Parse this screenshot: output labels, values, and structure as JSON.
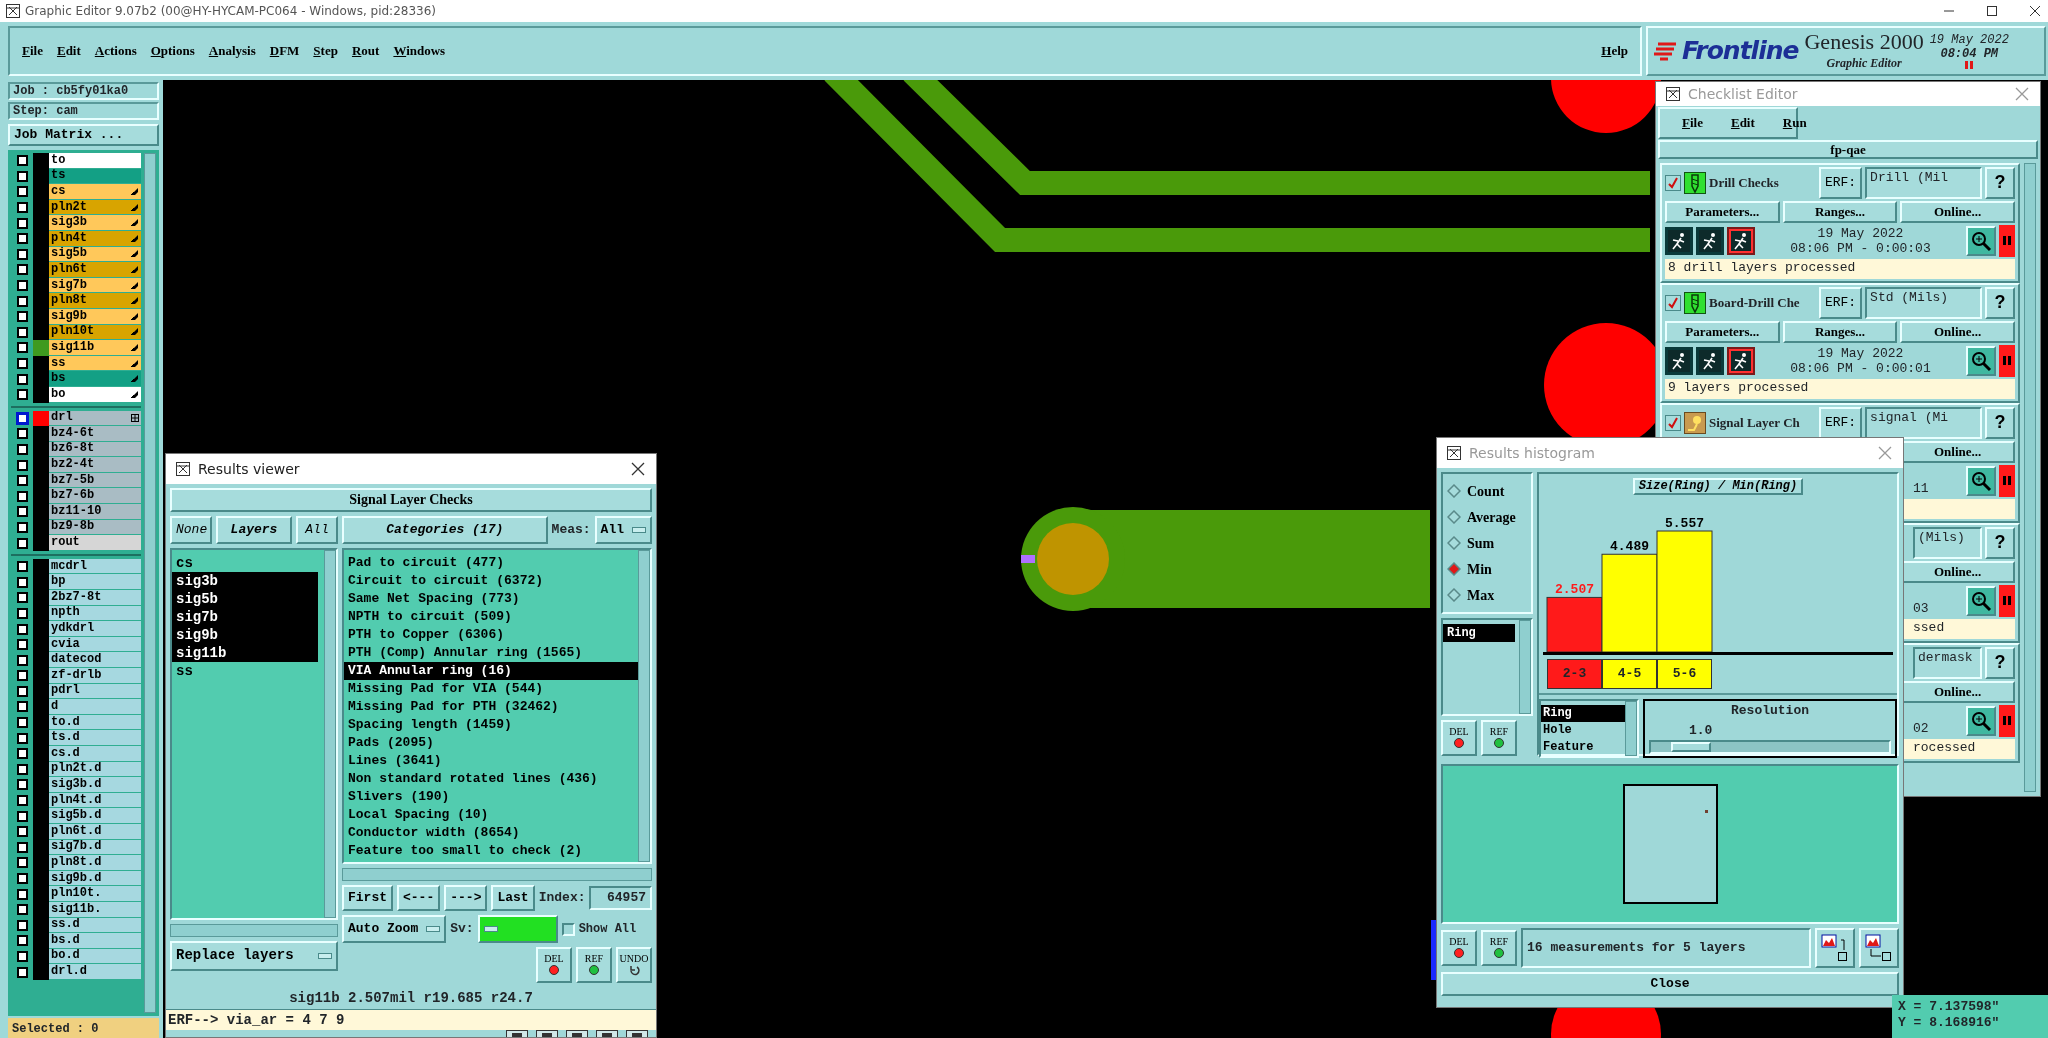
{
  "window": {
    "title": "Graphic Editor 9.07b2 (00@HY-HYCAM-PC064 - Windows, pid:28336)"
  },
  "menu": {
    "items": [
      "File",
      "Edit",
      "Actions",
      "Options",
      "Analysis",
      "DFM",
      "Step",
      "Rout",
      "Windows"
    ],
    "help": "Help"
  },
  "logo": {
    "brand": "Frontline",
    "product": "Genesis 2000",
    "subtitle": "Graphic Editor",
    "date": "19 May 2022",
    "time": "08:04 PM"
  },
  "job_panel": {
    "job": "Job : cb5fy01ka0",
    "step": "Step: cam",
    "matrix_button": "Job Matrix ...",
    "selected": "Selected : 0",
    "layer_groups": [
      [
        {
          "name": "to",
          "color": "#ffffff",
          "kind": "plain",
          "checked": false,
          "displayed": false,
          "work_layer": false
        },
        {
          "name": "ts",
          "color": "#13a085",
          "kind": "plain",
          "checked": false,
          "displayed": false,
          "work_layer": false
        },
        {
          "name": "cs",
          "color": "#ffc85a",
          "kind": "marked",
          "checked": false,
          "displayed": false,
          "work_layer": false
        },
        {
          "name": "pln2t",
          "color": "#d8a400",
          "kind": "marked",
          "checked": false,
          "displayed": false,
          "work_layer": false
        },
        {
          "name": "sig3b",
          "color": "#ffc85a",
          "kind": "marked",
          "checked": false,
          "displayed": false,
          "work_layer": false
        },
        {
          "name": "pln4t",
          "color": "#d8a400",
          "kind": "marked",
          "checked": false,
          "displayed": false,
          "work_layer": false
        },
        {
          "name": "sig5b",
          "color": "#ffc85a",
          "kind": "marked",
          "checked": false,
          "displayed": false,
          "work_layer": false
        },
        {
          "name": "pln6t",
          "color": "#d8a400",
          "kind": "marked",
          "checked": false,
          "displayed": false,
          "work_layer": false
        },
        {
          "name": "sig7b",
          "color": "#ffc85a",
          "kind": "marked",
          "checked": false,
          "displayed": false,
          "work_layer": false
        },
        {
          "name": "pln8t",
          "color": "#d8a400",
          "kind": "marked",
          "checked": false,
          "displayed": false,
          "work_layer": false
        },
        {
          "name": "sig9b",
          "color": "#ffc85a",
          "kind": "marked",
          "checked": false,
          "displayed": false,
          "work_layer": false
        },
        {
          "name": "pln10t",
          "color": "#d8a400",
          "kind": "marked",
          "checked": false,
          "displayed": false,
          "work_layer": false
        },
        {
          "name": "sig11b",
          "color": "#ffc85a",
          "kind": "marked",
          "checked": false,
          "displayed": true,
          "work_layer": false
        },
        {
          "name": "ss",
          "color": "#ffc85a",
          "kind": "marked",
          "checked": false,
          "displayed": false,
          "work_layer": false
        },
        {
          "name": "bs",
          "color": "#13a085",
          "kind": "marked",
          "checked": false,
          "displayed": false,
          "work_layer": false
        },
        {
          "name": "bo",
          "color": "#ffffff",
          "kind": "marked",
          "checked": false,
          "displayed": false,
          "work_layer": false
        }
      ],
      [
        {
          "name": "drl",
          "color": "#a9bcc4",
          "kind": "grid",
          "checked": false,
          "displayed": false,
          "work_layer": true
        },
        {
          "name": "bz4-6t",
          "color": "#a9bcc4",
          "kind": "plain",
          "checked": false,
          "displayed": false,
          "work_layer": false
        },
        {
          "name": "bz6-8t",
          "color": "#a9bcc4",
          "kind": "plain",
          "checked": false,
          "displayed": false,
          "work_layer": false
        },
        {
          "name": "bz2-4t",
          "color": "#a9bcc4",
          "kind": "plain",
          "checked": false,
          "displayed": false,
          "work_layer": false
        },
        {
          "name": "bz7-5b",
          "color": "#a9bcc4",
          "kind": "plain",
          "checked": false,
          "displayed": false,
          "work_layer": false
        },
        {
          "name": "bz7-6b",
          "color": "#a9bcc4",
          "kind": "plain",
          "checked": false,
          "displayed": false,
          "work_layer": false
        },
        {
          "name": "bz11-10",
          "color": "#a9bcc4",
          "kind": "plain",
          "checked": false,
          "displayed": false,
          "work_layer": false
        },
        {
          "name": "bz9-8b",
          "color": "#a9bcc4",
          "kind": "plain",
          "checked": false,
          "displayed": false,
          "work_layer": false
        },
        {
          "name": "rout",
          "color": "#d6d6d6",
          "kind": "plain",
          "checked": false,
          "displayed": false,
          "work_layer": false
        }
      ],
      [
        {
          "name": "mcdrl",
          "color": "#a6d8e0",
          "kind": "plain",
          "checked": false,
          "displayed": false,
          "work_layer": false
        },
        {
          "name": "bp",
          "color": "#a6d8e0",
          "kind": "plain",
          "checked": false,
          "displayed": false,
          "work_layer": false
        },
        {
          "name": "2bz7-8t",
          "color": "#a6d8e0",
          "kind": "plain",
          "checked": false,
          "displayed": false,
          "work_layer": false
        },
        {
          "name": "npth",
          "color": "#a6d8e0",
          "kind": "plain",
          "checked": false,
          "displayed": false,
          "work_layer": false
        },
        {
          "name": "ydkdrl",
          "color": "#a6d8e0",
          "kind": "plain",
          "checked": false,
          "displayed": false,
          "work_layer": false
        },
        {
          "name": "cvia",
          "color": "#a6d8e0",
          "kind": "plain",
          "checked": false,
          "displayed": false,
          "work_layer": false
        },
        {
          "name": "datecod",
          "color": "#a6d8e0",
          "kind": "plain",
          "checked": false,
          "displayed": false,
          "work_layer": false
        },
        {
          "name": "zf-drlb",
          "color": "#a6d8e0",
          "kind": "plain",
          "checked": false,
          "displayed": false,
          "work_layer": false
        },
        {
          "name": "pdrl",
          "color": "#a6d8e0",
          "kind": "plain",
          "checked": false,
          "displayed": false,
          "work_layer": false
        },
        {
          "name": "d",
          "color": "#a6d8e0",
          "kind": "plain",
          "checked": false,
          "displayed": false,
          "work_layer": false
        },
        {
          "name": "to.d",
          "color": "#a6d8e0",
          "kind": "plain",
          "checked": false,
          "displayed": false,
          "work_layer": false
        },
        {
          "name": "ts.d",
          "color": "#a6d8e0",
          "kind": "plain",
          "checked": false,
          "displayed": false,
          "work_layer": false
        },
        {
          "name": "cs.d",
          "color": "#a6d8e0",
          "kind": "plain",
          "checked": false,
          "displayed": false,
          "work_layer": false
        },
        {
          "name": "pln2t.d",
          "color": "#a6d8e0",
          "kind": "plain",
          "checked": false,
          "displayed": false,
          "work_layer": false
        },
        {
          "name": "sig3b.d",
          "color": "#a6d8e0",
          "kind": "plain",
          "checked": false,
          "displayed": false,
          "work_layer": false
        },
        {
          "name": "pln4t.d",
          "color": "#a6d8e0",
          "kind": "plain",
          "checked": false,
          "displayed": false,
          "work_layer": false
        },
        {
          "name": "sig5b.d",
          "color": "#a6d8e0",
          "kind": "plain",
          "checked": false,
          "displayed": false,
          "work_layer": false
        },
        {
          "name": "pln6t.d",
          "color": "#a6d8e0",
          "kind": "plain",
          "checked": false,
          "displayed": false,
          "work_layer": false
        },
        {
          "name": "sig7b.d",
          "color": "#a6d8e0",
          "kind": "plain",
          "checked": false,
          "displayed": false,
          "work_layer": false
        },
        {
          "name": "pln8t.d",
          "color": "#a6d8e0",
          "kind": "plain",
          "checked": false,
          "displayed": false,
          "work_layer": false
        },
        {
          "name": "sig9b.d",
          "color": "#a6d8e0",
          "kind": "plain",
          "checked": false,
          "displayed": false,
          "work_layer": false
        },
        {
          "name": "pln10t.",
          "color": "#a6d8e0",
          "kind": "plain",
          "checked": false,
          "displayed": false,
          "work_layer": false
        },
        {
          "name": "sig11b.",
          "color": "#a6d8e0",
          "kind": "plain",
          "checked": false,
          "displayed": false,
          "work_layer": false
        },
        {
          "name": "ss.d",
          "color": "#a6d8e0",
          "kind": "plain",
          "checked": false,
          "displayed": false,
          "work_layer": false
        },
        {
          "name": "bs.d",
          "color": "#a6d8e0",
          "kind": "plain",
          "checked": false,
          "displayed": false,
          "work_layer": false
        },
        {
          "name": "bo.d",
          "color": "#a6d8e0",
          "kind": "plain",
          "checked": false,
          "displayed": false,
          "work_layer": false
        },
        {
          "name": "drl.d",
          "color": "#a6d8e0",
          "kind": "plain",
          "checked": false,
          "displayed": false,
          "work_layer": false
        }
      ]
    ]
  },
  "results_viewer": {
    "title": "Results viewer",
    "check": "Signal Layer Checks",
    "layer_buttons": [
      "None",
      "Layers",
      "All"
    ],
    "layers": [
      {
        "name": "cs",
        "selected": false
      },
      {
        "name": "sig3b",
        "selected": true
      },
      {
        "name": "sig5b",
        "selected": true
      },
      {
        "name": "sig7b",
        "selected": true
      },
      {
        "name": "sig9b",
        "selected": true
      },
      {
        "name": "sig11b",
        "selected": true
      },
      {
        "name": "ss",
        "selected": false
      }
    ],
    "replace": "Replace layers",
    "categories_header": "Categories (17)",
    "meas_label": "Meas:",
    "meas_value": "All",
    "categories": [
      {
        "label": "Pad to circuit (477)",
        "selected": false
      },
      {
        "label": "Circuit to circuit (6372)",
        "selected": false
      },
      {
        "label": "Same Net Spacing (773)",
        "selected": false
      },
      {
        "label": "NPTH to circuit (509)",
        "selected": false
      },
      {
        "label": "PTH to Copper (6306)",
        "selected": false
      },
      {
        "label": "PTH (Comp) Annular ring (1565)",
        "selected": false
      },
      {
        "label": "VIA Annular ring (16)",
        "selected": true
      },
      {
        "label": "Missing Pad for VIA (544)",
        "selected": false
      },
      {
        "label": "Missing Pad for PTH (32462)",
        "selected": false
      },
      {
        "label": "Spacing length (1459)",
        "selected": false
      },
      {
        "label": "Pads (2095)",
        "selected": false
      },
      {
        "label": "Lines (3641)",
        "selected": false
      },
      {
        "label": "Non standard rotated lines (436)",
        "selected": false
      },
      {
        "label": "Slivers (190)",
        "selected": false
      },
      {
        "label": "Local Spacing (10)",
        "selected": false
      },
      {
        "label": "Conductor width (8654)",
        "selected": false
      },
      {
        "label": "Feature too small to check (2)",
        "selected": false
      }
    ],
    "nav": [
      "First",
      "<---",
      "--->",
      "Last"
    ],
    "index_label": "Index:",
    "index_value": "64957",
    "zoom_mode": "Auto Zoom",
    "sv_label": "Sv:",
    "show_all": {
      "label": "Show All",
      "checked": false
    },
    "tools": [
      {
        "label": "DEL",
        "kind": "del"
      },
      {
        "label": "REF",
        "kind": "ref"
      },
      {
        "label": "UNDO",
        "kind": "undo"
      }
    ],
    "status": "sig11b 2.507mil r19.685 r24.7",
    "erf_line": "ERF--> via_ar = 4 7 9"
  },
  "checklist": {
    "title": "Checklist Editor",
    "menu": [
      "File",
      "Edit",
      "Run"
    ],
    "name": "fp-qae",
    "checks": [
      {
        "name": "Drill Checks",
        "checked": true,
        "kind": "drill",
        "erf_label": "ERF:",
        "erf_value": "Drill (Mil",
        "help": "?",
        "buttons": [
          "Parameters...",
          "Ranges...",
          "Online..."
        ],
        "date": "19 May 2022",
        "time": "08:06 PM - 0:00:03",
        "status": "8 drill layers processed"
      },
      {
        "name": "Board-Drill Che",
        "checked": true,
        "kind": "drill",
        "erf_label": "ERF:",
        "erf_value": "Std (Mils)",
        "help": "?",
        "buttons": [
          "Parameters...",
          "Ranges...",
          "Online..."
        ],
        "date": "19 May 2022",
        "time": "08:06 PM - 0:00:01",
        "status": "9 layers processed"
      },
      {
        "name": "Signal Layer Ch",
        "checked": true,
        "kind": "signal",
        "erf_label": "ERF:",
        "erf_value": "signal (Mi",
        "help": "?",
        "buttons": [
          "Online..."
        ],
        "time": "11"
      },
      {
        "erf_value": "(Mils)",
        "help": "?",
        "buttons": [
          "Online..."
        ],
        "time": "03",
        "status": "ssed"
      },
      {
        "erf_value": "dermask",
        "help": "?",
        "buttons": [
          "Online..."
        ],
        "time": "02",
        "status": "rocessed"
      }
    ]
  },
  "histogram": {
    "title": "Results histogram",
    "modes": [
      {
        "label": "Count",
        "selected": false
      },
      {
        "label": "Average",
        "selected": false
      },
      {
        "label": "Sum",
        "selected": false
      },
      {
        "label": "Min",
        "selected": true
      },
      {
        "label": "Max",
        "selected": false
      }
    ],
    "attributes": [
      {
        "label": "Ring",
        "selected": true
      }
    ],
    "tools": [
      {
        "label": "DEL",
        "kind": "del"
      },
      {
        "label": "REF",
        "kind": "ref"
      }
    ],
    "chart_data": {
      "type": "bar",
      "title": "Size(Ring) / Min(Ring)",
      "categories": [
        "2-3",
        "4-5",
        "5-6"
      ],
      "series": [
        {
          "color": "#ff1a1a",
          "values": [
            2.507,
            null,
            null
          ]
        },
        {
          "color": "#ffff00",
          "values": [
            null,
            4.489,
            5.557
          ]
        }
      ],
      "stacked": true,
      "data_labels": true
    },
    "fields": [
      {
        "label": "Ring",
        "selected": true
      },
      {
        "label": "Hole",
        "selected": false
      },
      {
        "label": "Feature",
        "selected": false
      }
    ],
    "resolution": {
      "label": "Resolution",
      "value": "1.0",
      "level": 0.1
    },
    "bottom_tools": [
      {
        "label": "DEL",
        "kind": "del"
      },
      {
        "label": "REF",
        "kind": "ref"
      }
    ],
    "summary": "16 measurements for 5 layers",
    "close": "Close"
  },
  "coordinates": {
    "x": "X = 7.137598\"",
    "y": "Y = 8.168916\""
  }
}
